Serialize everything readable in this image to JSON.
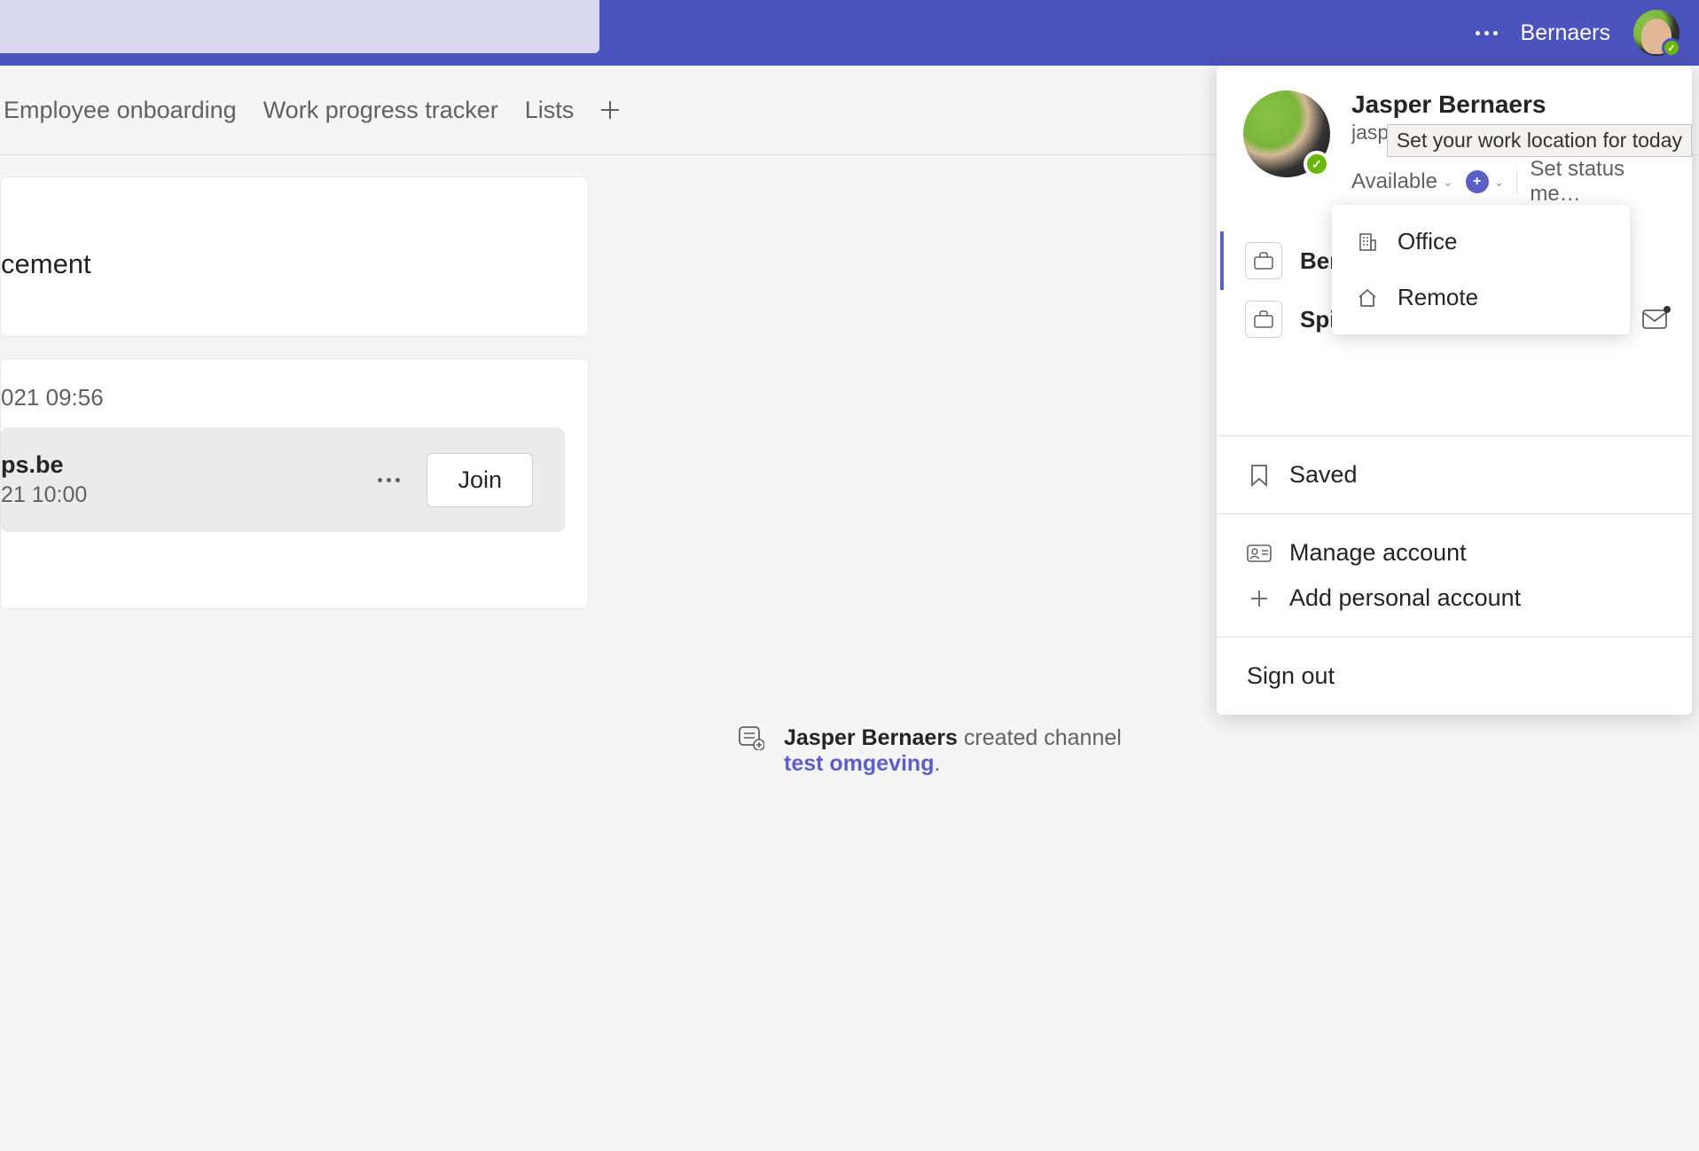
{
  "header": {
    "username": "Bernaers"
  },
  "tabs": {
    "tab1": "Employee onboarding",
    "tab2": "Work progress tracker",
    "tab3": "Lists"
  },
  "card1": {
    "text_fragment": "cement"
  },
  "card2": {
    "timestamp": "021 09:56",
    "meeting_title": "ps.be",
    "meeting_time": "21 10:00",
    "join_label": "Join"
  },
  "profile": {
    "name": "Jasper Bernaers",
    "email": "jasper@be",
    "status": "Available",
    "set_status_label": "Set status me…",
    "tooltip": "Set your work location for today",
    "org1": "Bern",
    "org2": "Spil",
    "location_options": {
      "office": "Office",
      "remote": "Remote"
    },
    "menu": {
      "saved": "Saved",
      "manage": "Manage account",
      "add": "Add personal account",
      "signout": "Sign out"
    }
  },
  "activity": {
    "author": "Jasper Bernaers",
    "action": " created channel ",
    "link": "test omgeving",
    "period": "."
  }
}
